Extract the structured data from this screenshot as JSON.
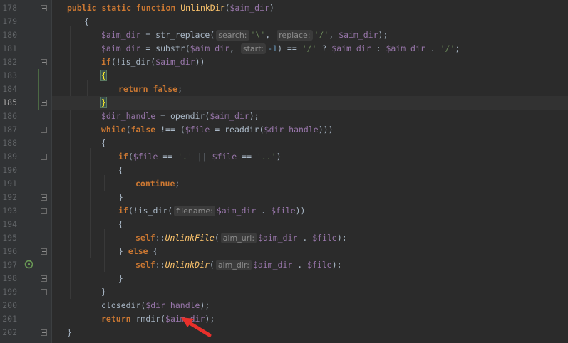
{
  "editor": {
    "current_line": "185",
    "arrow_color": "#e8302b",
    "accent_keyword": "#cc7832",
    "function_color": "#ffc66d",
    "variable_color": "#9876aa",
    "string_color": "#6a8759",
    "number_color": "#6897bb",
    "gutter_icon": "recursive-call-icon",
    "annotation_icon": "red-arrow-icon"
  },
  "lines": [
    {
      "num": "178",
      "indent": 0,
      "fold": "start",
      "tokens": [
        [
          "kw",
          "public static function "
        ],
        [
          "fn",
          "UnlinkDir"
        ],
        [
          "pl",
          "("
        ],
        [
          "var",
          "$aim_dir"
        ],
        [
          "pl",
          ")"
        ]
      ]
    },
    {
      "num": "179",
      "indent": 1,
      "fold": "",
      "tokens": [
        [
          "pl",
          "{"
        ]
      ]
    },
    {
      "num": "180",
      "indent": 2,
      "fold": "",
      "tokens": [
        [
          "var",
          "$aim_dir"
        ],
        [
          "pl",
          " = str_replace("
        ],
        [
          "hint",
          "search:"
        ],
        [
          "str",
          "'\\'"
        ],
        [
          "pl",
          ", "
        ],
        [
          "hint",
          "replace:"
        ],
        [
          "str",
          "'/'"
        ],
        [
          "pl",
          ", "
        ],
        [
          "var",
          "$aim_dir"
        ],
        [
          "pl",
          ");"
        ]
      ]
    },
    {
      "num": "181",
      "indent": 2,
      "fold": "",
      "tokens": [
        [
          "var",
          "$aim_dir"
        ],
        [
          "pl",
          " = substr("
        ],
        [
          "var",
          "$aim_dir"
        ],
        [
          "pl",
          ", "
        ],
        [
          "hint",
          "start:"
        ],
        [
          "num",
          "-1"
        ],
        [
          "pl",
          ") == "
        ],
        [
          "str",
          "'/'"
        ],
        [
          "pl",
          " ? "
        ],
        [
          "var",
          "$aim_dir"
        ],
        [
          "pl",
          " : "
        ],
        [
          "var",
          "$aim_dir"
        ],
        [
          "pl",
          " . "
        ],
        [
          "str",
          "'/'"
        ],
        [
          "pl",
          ";"
        ]
      ]
    },
    {
      "num": "182",
      "indent": 2,
      "fold": "start",
      "tokens": [
        [
          "kw",
          "if"
        ],
        [
          "pl",
          "(!is_dir("
        ],
        [
          "var",
          "$aim_dir"
        ],
        [
          "pl",
          "))"
        ]
      ]
    },
    {
      "num": "183",
      "indent": 2,
      "fold": "",
      "tokens": [
        [
          "brace",
          "{"
        ]
      ]
    },
    {
      "num": "184",
      "indent": 3,
      "fold": "",
      "tokens": [
        [
          "kw",
          "return false"
        ],
        [
          "pl",
          ";"
        ]
      ]
    },
    {
      "num": "185",
      "indent": 2,
      "fold": "end",
      "tokens": [
        [
          "brace",
          "}"
        ]
      ]
    },
    {
      "num": "186",
      "indent": 2,
      "fold": "",
      "tokens": [
        [
          "var",
          "$dir_handle"
        ],
        [
          "pl",
          " = opendir("
        ],
        [
          "var",
          "$aim_dir"
        ],
        [
          "pl",
          ");"
        ]
      ]
    },
    {
      "num": "187",
      "indent": 2,
      "fold": "start",
      "tokens": [
        [
          "kw",
          "while"
        ],
        [
          "pl",
          "("
        ],
        [
          "kw",
          "false"
        ],
        [
          "pl",
          " !== ("
        ],
        [
          "var",
          "$file"
        ],
        [
          "pl",
          " = readdir("
        ],
        [
          "var",
          "$dir_handle"
        ],
        [
          "pl",
          "))"
        ],
        [
          "pl",
          ")"
        ]
      ]
    },
    {
      "num": "188",
      "indent": 2,
      "fold": "",
      "tokens": [
        [
          "pl",
          "{"
        ]
      ]
    },
    {
      "num": "189",
      "indent": 3,
      "fold": "start",
      "tokens": [
        [
          "kw",
          "if"
        ],
        [
          "pl",
          "("
        ],
        [
          "var",
          "$file"
        ],
        [
          "pl",
          " == "
        ],
        [
          "str",
          "'.'"
        ],
        [
          "pl",
          " || "
        ],
        [
          "var",
          "$file"
        ],
        [
          "pl",
          " == "
        ],
        [
          "str",
          "'..'"
        ],
        [
          "pl",
          ")"
        ]
      ]
    },
    {
      "num": "190",
      "indent": 3,
      "fold": "",
      "tokens": [
        [
          "pl",
          "{"
        ]
      ]
    },
    {
      "num": "191",
      "indent": 4,
      "fold": "",
      "tokens": [
        [
          "kw",
          "continue"
        ],
        [
          "pl",
          ";"
        ]
      ]
    },
    {
      "num": "192",
      "indent": 3,
      "fold": "end",
      "tokens": [
        [
          "pl",
          "}"
        ]
      ]
    },
    {
      "num": "193",
      "indent": 3,
      "fold": "start",
      "tokens": [
        [
          "kw",
          "if"
        ],
        [
          "pl",
          "(!is_dir("
        ],
        [
          "hint",
          "filename:"
        ],
        [
          "var",
          "$aim_dir"
        ],
        [
          "pl",
          " . "
        ],
        [
          "var",
          "$file"
        ],
        [
          "pl",
          "))"
        ]
      ]
    },
    {
      "num": "194",
      "indent": 3,
      "fold": "",
      "tokens": [
        [
          "pl",
          "{"
        ]
      ]
    },
    {
      "num": "195",
      "indent": 4,
      "fold": "",
      "tokens": [
        [
          "kw",
          "self"
        ],
        [
          "pl",
          "::"
        ],
        [
          "fni",
          "UnlinkFile"
        ],
        [
          "pl",
          "("
        ],
        [
          "hint",
          "aim_url:"
        ],
        [
          "var",
          "$aim_dir"
        ],
        [
          "pl",
          " . "
        ],
        [
          "var",
          "$file"
        ],
        [
          "pl",
          ");"
        ]
      ]
    },
    {
      "num": "196",
      "indent": 3,
      "fold": "start",
      "tokens": [
        [
          "pl",
          "} "
        ],
        [
          "kw",
          "else"
        ],
        [
          "pl",
          " {"
        ]
      ]
    },
    {
      "num": "197",
      "indent": 4,
      "fold": "",
      "tokens": [
        [
          "kw",
          "self"
        ],
        [
          "pl",
          "::"
        ],
        [
          "fni",
          "UnlinkDir"
        ],
        [
          "pl",
          "("
        ],
        [
          "hint",
          "aim_dir:"
        ],
        [
          "var",
          "$aim_dir"
        ],
        [
          "pl",
          " . "
        ],
        [
          "var",
          "$file"
        ],
        [
          "pl",
          ");"
        ]
      ]
    },
    {
      "num": "198",
      "indent": 3,
      "fold": "end",
      "tokens": [
        [
          "pl",
          "}"
        ]
      ]
    },
    {
      "num": "199",
      "indent": 2,
      "fold": "end",
      "tokens": [
        [
          "pl",
          "}"
        ]
      ]
    },
    {
      "num": "200",
      "indent": 2,
      "fold": "",
      "tokens": [
        [
          "pl",
          "closedir("
        ],
        [
          "var",
          "$dir_handle"
        ],
        [
          "pl",
          ");"
        ]
      ]
    },
    {
      "num": "201",
      "indent": 2,
      "fold": "",
      "tokens": [
        [
          "kw",
          "return "
        ],
        [
          "pl",
          "rmdir("
        ],
        [
          "var",
          "$aim_dir"
        ],
        [
          "pl",
          ");"
        ]
      ]
    },
    {
      "num": "202",
      "indent": 0,
      "fold": "end",
      "tokens": [
        [
          "pl",
          "}"
        ]
      ]
    }
  ]
}
